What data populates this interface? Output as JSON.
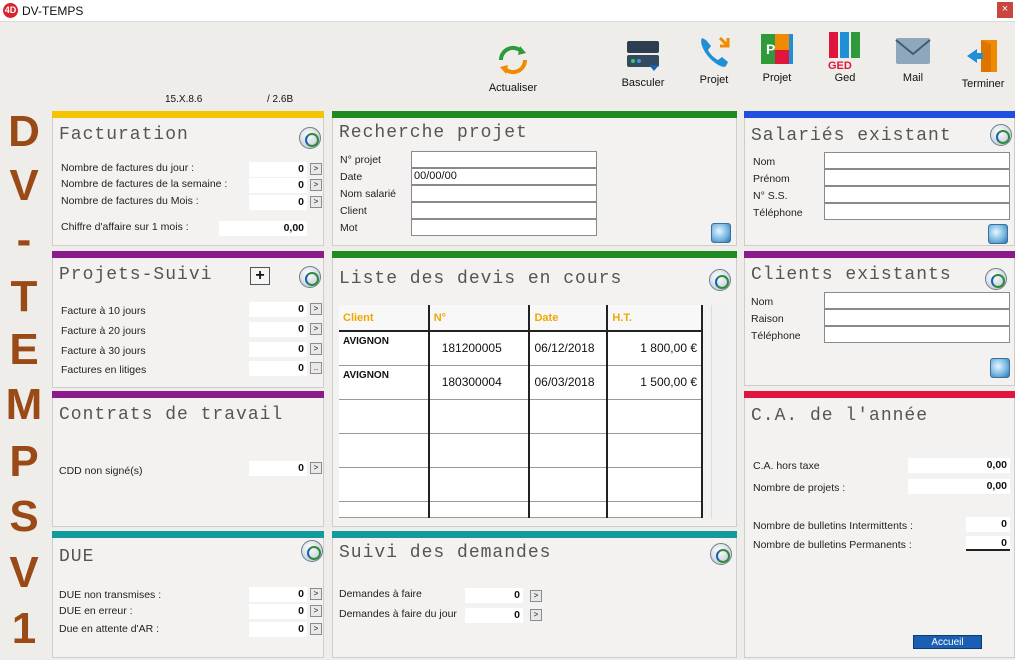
{
  "window": {
    "title": "DV-TEMPS",
    "logo_text": "4D",
    "close_symbol": "×"
  },
  "version": {
    "left": "15.X.8.6",
    "right": "/  2.6B"
  },
  "side_letters": [
    "D",
    "V",
    "-",
    "T",
    "E",
    "M",
    "P",
    "S",
    "V",
    "1"
  ],
  "toolbar": {
    "actualiser": "Actualiser",
    "basculer": "Basculer",
    "projet_phone": "Projet",
    "projet": "Projet",
    "ged": "Ged",
    "mail": "Mail",
    "terminer": "Terminer",
    "ged_logo": "GED"
  },
  "facturation": {
    "title": "Facturation",
    "rows": [
      {
        "label": "Nombre de factures du jour :",
        "value": "0"
      },
      {
        "label": "Nombre de factures de la semaine :",
        "value": "0"
      },
      {
        "label": "Nombre de factures du Mois :",
        "value": "0"
      }
    ],
    "ca_label": "Chiffre d'affaire sur 1 mois :",
    "ca_value": "0,00"
  },
  "recherche": {
    "title": "Recherche projet",
    "fields": [
      {
        "label": "N° projet",
        "value": ""
      },
      {
        "label": "Date",
        "value": "00/00/00"
      },
      {
        "label": "Nom salarié",
        "value": ""
      },
      {
        "label": "Client",
        "value": ""
      },
      {
        "label": "Mot",
        "value": ""
      }
    ]
  },
  "salaries": {
    "title": "Salariés existant",
    "fields": [
      {
        "label": "Nom"
      },
      {
        "label": "Prénom"
      },
      {
        "label": "N° S.S."
      },
      {
        "label": "Téléphone"
      }
    ]
  },
  "projets_suivi": {
    "title": "Projets-Suivi",
    "plus": "+",
    "rows": [
      {
        "label": "Facture à 10 jours",
        "value": "0",
        "btn": ">"
      },
      {
        "label": "Facture à 20 jours",
        "value": "0",
        "btn": ">"
      },
      {
        "label": "Facture à 30 jours",
        "value": "0",
        "btn": ">"
      },
      {
        "label": "Factures en litiges",
        "value": "0",
        "btn": ".."
      }
    ]
  },
  "devis": {
    "title": "Liste des devis en cours",
    "headers": [
      "Client",
      "N°",
      "Date",
      "H.T."
    ],
    "rows": [
      [
        "AVIGNON",
        "181200005",
        "06/12/2018",
        "1 800,00 €"
      ],
      [
        "AVIGNON",
        "180300004",
        "06/03/2018",
        "1 500,00 €"
      ]
    ]
  },
  "clients": {
    "title": "Clients existants",
    "fields": [
      {
        "label": "Nom"
      },
      {
        "label": "Raison"
      },
      {
        "label": "Téléphone"
      }
    ]
  },
  "contrats": {
    "title": "Contrats de travail",
    "rows": [
      {
        "label": "CDD non signé(s)",
        "value": "0"
      }
    ]
  },
  "ca_annee": {
    "title": "C.A. de l'année",
    "rows": [
      {
        "label": "C.A. hors taxe",
        "value": "0,00"
      },
      {
        "label": "Nombre de projets :",
        "value": "0,00"
      }
    ],
    "bulletins": [
      {
        "label": "Nombre de bulletins Intermittents :",
        "value": "0"
      },
      {
        "label": "Nombre de bulletins Permanents :",
        "value": "0"
      }
    ],
    "accueil": "Accueil"
  },
  "due": {
    "title": "DUE",
    "rows": [
      {
        "label": "DUE non transmises :",
        "value": "0"
      },
      {
        "label": "DUE en erreur :",
        "value": "0"
      },
      {
        "label": "Due en attente d'AR :",
        "value": "0"
      }
    ]
  },
  "suivi_demandes": {
    "title": "Suivi des demandes",
    "rows": [
      {
        "label": "Demandes à faire",
        "value": "0"
      },
      {
        "label": "Demandes à faire du jour",
        "value": "0"
      }
    ]
  },
  "colors": {
    "facturation": "#f5c400",
    "recherche": "#1f8a22",
    "salaries": "#1f4ee0",
    "projets": "#8b1a8b",
    "devis": "#1f8a22",
    "clients": "#8b1a8b",
    "contrats": "#8b1a8b",
    "ca": "#e0163c",
    "due": "#139a9a",
    "suivi": "#139a9a"
  },
  "icons": {
    "go": "refresh-arrow-icon",
    "search": "magnifier-icon"
  }
}
